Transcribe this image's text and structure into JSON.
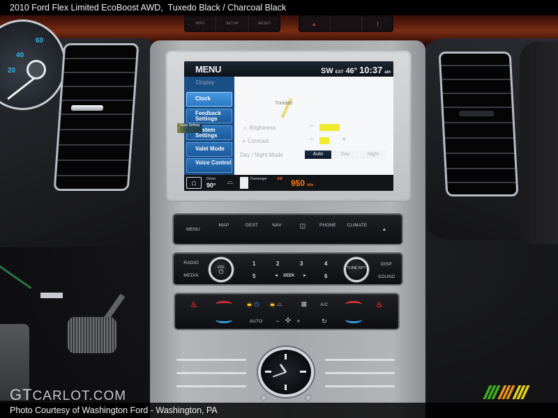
{
  "page": {
    "title": "2010 Ford Flex Limited EcoBoost AWD,  Tuxedo Black / Charcoal Black",
    "credit": "Photo Courtesy of Washington Ford - Washington, PA",
    "watermark": {
      "prefix": "GT",
      "suffix": "CARLOT.COM"
    },
    "brand_stripes": [
      "#3fae1c",
      "#3fae1c",
      "#3fae1c",
      "#e8901a",
      "#e8901a",
      "#e8901a",
      "#e2d21a",
      "#e2d21a",
      "#e2d21a"
    ]
  },
  "dash_top_buttons": {
    "left_group": [
      "INFO",
      "SETUP",
      "RESET"
    ],
    "right_group": [
      "hazard-icon",
      "",
      "defrost-icon"
    ]
  },
  "gauge": {
    "numbers": [
      "60",
      "40",
      "20"
    ],
    "needle_color": "#f2f2f2",
    "number_color": "#37b4e6"
  },
  "screen": {
    "header": {
      "title": "MENU",
      "compass": "SW",
      "ext_label": "EXT",
      "temperature": "46°",
      "time": "10:37",
      "ampm": "am"
    },
    "sidebar": {
      "heading": "Display",
      "items": [
        {
          "label": "Clock",
          "active": true
        },
        {
          "label": "Feedback Settings",
          "active": false
        },
        {
          "label": "System Settings",
          "active": false
        },
        {
          "label": "Valet Mode",
          "active": false
        },
        {
          "label": "Voice Control",
          "active": false
        }
      ]
    },
    "map_label": "Trinidad",
    "settings": {
      "brightness_label": "Brightness",
      "brightness_level": 0.6,
      "contrast_label": "Contrast",
      "contrast_level": 0.3,
      "minus": "−",
      "plus": "+",
      "setting_button": "Save Setting",
      "mode_label": "Day / Night Mode",
      "modes": [
        {
          "label": "Auto",
          "active": true
        },
        {
          "label": "Day",
          "active": false
        },
        {
          "label": "Night",
          "active": false
        }
      ]
    },
    "footer": {
      "home_icon": "⌂",
      "driver_label": "Driver",
      "driver_temp": "90°",
      "defrost_icon": "defrost-icon",
      "passenger_label": "Passenger",
      "band": "AM",
      "frequency": "950",
      "unit": "kHz"
    },
    "colors": {
      "sidebar_blue": "#2b73ba",
      "bar_yellow": "#f2ea2f",
      "freq_orange": "#ff7a1a"
    }
  },
  "nav_panel": {
    "buttons": [
      "MENU",
      "MAP",
      "DEST",
      "NAV",
      "◫",
      "PHONE",
      "CLIMATE",
      "▲"
    ]
  },
  "audio_panel": {
    "left": [
      "RADIO",
      "MEDIA"
    ],
    "vol_knob": "VOL",
    "presets_top": [
      "1",
      "2",
      "3",
      "4"
    ],
    "presets_bottom": [
      "5",
      "◄",
      "SEEK",
      "►",
      "6"
    ],
    "tune_knob": "TUNE RPT",
    "right": [
      "DISP",
      "SOUND"
    ]
  },
  "climate_panel": {
    "power_icon": "⏻",
    "defrost_icon": "⌓",
    "rear_defrost_icon": "▦",
    "ac_label": "A/C",
    "auto_label": "AUTO",
    "fan_minus": "−",
    "fan_icon": "✣",
    "fan_plus": "+",
    "recirc_icon": "↻",
    "seat_icon": "♨"
  }
}
